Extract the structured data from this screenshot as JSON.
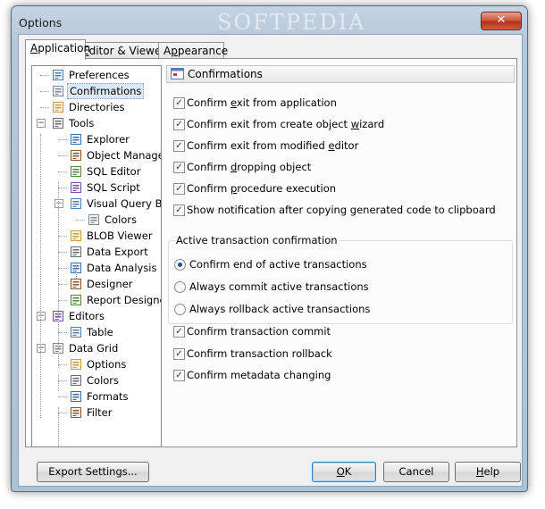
{
  "window": {
    "title": "Options",
    "watermark": "SOFTPEDIA",
    "close_glyph": "✕"
  },
  "tabs": [
    {
      "label_pre": "",
      "label_key": "A",
      "label_post": "pplication",
      "active": true
    },
    {
      "label_pre": "",
      "label_key": "E",
      "label_post": "ditor & Viewers",
      "active": false
    },
    {
      "label_pre": "A",
      "label_key": "p",
      "label_post": "pearance",
      "active": false
    }
  ],
  "tree": [
    {
      "label": "Preferences",
      "level": 1,
      "icon": "preferences-icon"
    },
    {
      "label": "Confirmations",
      "level": 1,
      "icon": "confirmations-icon",
      "selected": true
    },
    {
      "label": "Directories",
      "level": 1,
      "icon": "directories-icon"
    },
    {
      "label": "Tools",
      "level": 1,
      "icon": "tools-icon",
      "expander": "−"
    },
    {
      "label": "Explorer",
      "level": 2,
      "icon": "explorer-icon"
    },
    {
      "label": "Object Manager",
      "level": 2,
      "icon": "object-manager-icon"
    },
    {
      "label": "SQL Editor",
      "level": 2,
      "icon": "sql-editor-icon"
    },
    {
      "label": "SQL Script",
      "level": 2,
      "icon": "sql-script-icon"
    },
    {
      "label": "Visual Query Builder",
      "level": 2,
      "icon": "visual-query-builder-icon",
      "expander": "−"
    },
    {
      "label": "Colors",
      "level": 3,
      "icon": "colors-icon"
    },
    {
      "label": "BLOB Viewer",
      "level": 2,
      "icon": "blob-viewer-icon"
    },
    {
      "label": "Data Export",
      "level": 2,
      "icon": "data-export-icon"
    },
    {
      "label": "Data Analysis",
      "level": 2,
      "icon": "data-analysis-icon"
    },
    {
      "label": "Designer",
      "level": 2,
      "icon": "designer-icon"
    },
    {
      "label": "Report Designer",
      "level": 2,
      "icon": "report-designer-icon"
    },
    {
      "label": "Editors",
      "level": 1,
      "icon": "editors-icon",
      "expander": "−"
    },
    {
      "label": "Table",
      "level": 2,
      "icon": "table-icon"
    },
    {
      "label": "Data Grid",
      "level": 1,
      "icon": "data-grid-icon",
      "expander": "−"
    },
    {
      "label": "Options",
      "level": 2,
      "icon": "options-icon"
    },
    {
      "label": "Colors",
      "level": 2,
      "icon": "grid-colors-icon"
    },
    {
      "label": "Formats",
      "level": 2,
      "icon": "formats-icon"
    },
    {
      "label": "Filter",
      "level": 2,
      "icon": "filter-icon"
    }
  ],
  "section": {
    "title": "Confirmations"
  },
  "checkboxes_top": [
    {
      "pre": "Confirm ",
      "key": "e",
      "post": "xit from application",
      "checked": true
    },
    {
      "pre": "Confirm exit from create object ",
      "key": "w",
      "post": "izard",
      "checked": true
    },
    {
      "pre": "Confirm exit from modified ",
      "key": "e",
      "post": "ditor",
      "checked": true
    },
    {
      "pre": "Confirm ",
      "key": "d",
      "post": "ropping object",
      "checked": true
    },
    {
      "pre": "Confirm ",
      "key": "p",
      "post": "rocedure execution",
      "checked": true
    },
    {
      "pre": "Show notification after copying generated code to clipboard",
      "key": "",
      "post": "",
      "checked": true
    }
  ],
  "transaction_group": {
    "title": "Active transaction confirmation",
    "options": [
      {
        "label": "Confirm end of active transactions",
        "selected": true
      },
      {
        "label": "Always commit active transactions",
        "selected": false
      },
      {
        "label": "Always rollback active transactions",
        "selected": false
      }
    ]
  },
  "checkboxes_bottom": [
    {
      "pre": "Confirm transaction commit",
      "key": "",
      "post": "",
      "checked": true
    },
    {
      "pre": "Confirm transaction rollback",
      "key": "",
      "post": "",
      "checked": true
    },
    {
      "pre": "Confirm metadata changing",
      "key": "",
      "post": "",
      "checked": true
    }
  ],
  "check_glyph": "✓",
  "buttons": {
    "export": "Export Settings...",
    "ok_key": "O",
    "ok_post": "K",
    "cancel": "Cancel",
    "help_key": "H",
    "help_post": "elp"
  }
}
